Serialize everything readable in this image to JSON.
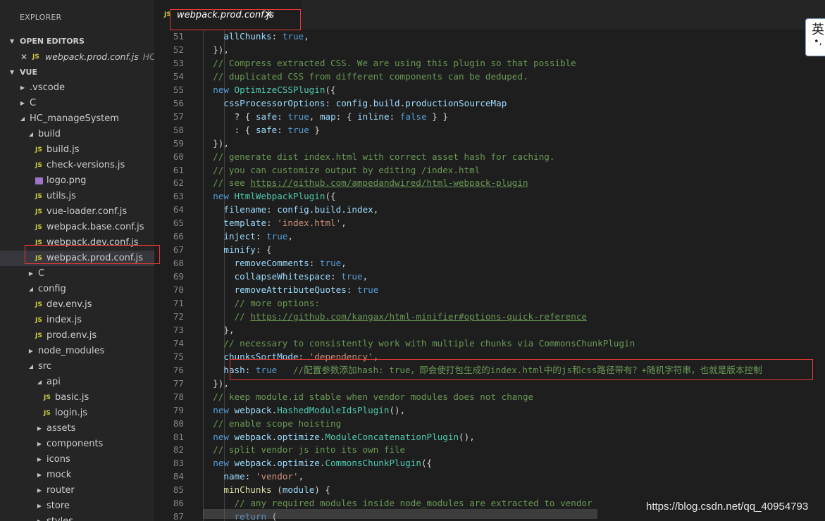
{
  "sidebar": {
    "title": "EXPLORER",
    "open_editors_label": "OPEN EDITORS",
    "open_editor": {
      "name": "webpack.prod.conf.js",
      "path": "HC_..."
    },
    "workspace_label": "VUE",
    "tree": [
      {
        "label": ".vscode",
        "depth": 0,
        "kind": "folder",
        "open": false
      },
      {
        "label": "C",
        "depth": 0,
        "kind": "folder",
        "open": false
      },
      {
        "label": "HC_manageSystem",
        "depth": 0,
        "kind": "folder",
        "open": true
      },
      {
        "label": "build",
        "depth": 1,
        "kind": "folder",
        "open": true
      },
      {
        "label": "build.js",
        "depth": 2,
        "kind": "js"
      },
      {
        "label": "check-versions.js",
        "depth": 2,
        "kind": "js"
      },
      {
        "label": "logo.png",
        "depth": 2,
        "kind": "image"
      },
      {
        "label": "utils.js",
        "depth": 2,
        "kind": "js"
      },
      {
        "label": "vue-loader.conf.js",
        "depth": 2,
        "kind": "js"
      },
      {
        "label": "webpack.base.conf.js",
        "depth": 2,
        "kind": "js"
      },
      {
        "label": "webpack.dev.conf.js",
        "depth": 2,
        "kind": "js"
      },
      {
        "label": "webpack.prod.conf.js",
        "depth": 2,
        "kind": "js",
        "selected": true
      },
      {
        "label": "C",
        "depth": 1,
        "kind": "folder",
        "open": false
      },
      {
        "label": "config",
        "depth": 1,
        "kind": "folder",
        "open": true
      },
      {
        "label": "dev.env.js",
        "depth": 2,
        "kind": "js"
      },
      {
        "label": "index.js",
        "depth": 2,
        "kind": "js"
      },
      {
        "label": "prod.env.js",
        "depth": 2,
        "kind": "js"
      },
      {
        "label": "node_modules",
        "depth": 1,
        "kind": "folder",
        "open": false
      },
      {
        "label": "src",
        "depth": 1,
        "kind": "folder",
        "open": true
      },
      {
        "label": "api",
        "depth": 2,
        "kind": "folder",
        "open": true
      },
      {
        "label": "basic.js",
        "depth": 3,
        "kind": "js"
      },
      {
        "label": "login.js",
        "depth": 3,
        "kind": "js"
      },
      {
        "label": "assets",
        "depth": 2,
        "kind": "folder",
        "open": false
      },
      {
        "label": "components",
        "depth": 2,
        "kind": "folder",
        "open": false
      },
      {
        "label": "icons",
        "depth": 2,
        "kind": "folder",
        "open": false
      },
      {
        "label": "mock",
        "depth": 2,
        "kind": "folder",
        "open": false
      },
      {
        "label": "router",
        "depth": 2,
        "kind": "folder",
        "open": false
      },
      {
        "label": "store",
        "depth": 2,
        "kind": "folder",
        "open": false
      },
      {
        "label": "styles",
        "depth": 2,
        "kind": "folder",
        "open": false
      }
    ]
  },
  "tab": {
    "icon": "JS",
    "name": "webpack.prod.conf.js",
    "close": "✕"
  },
  "js_badge": "JS",
  "ime": {
    "main": "英",
    "sub": "•,"
  },
  "watermark": "https://blog.csdn.net/qq_40954793",
  "colors": {
    "keyword": "#569cd6",
    "comment": "#6a9955",
    "string": "#ce9178",
    "property": "#9cdcfe",
    "class": "#4ec9b0",
    "method": "#dcdcaa",
    "highlight": "#e53935"
  },
  "code_lines": [
    {
      "n": 51,
      "indent": 4,
      "tokens": [
        [
          "p",
          "allChunks"
        ],
        [
          "t",
          ": "
        ],
        [
          "k",
          "true"
        ],
        [
          "t",
          ","
        ]
      ]
    },
    {
      "n": 52,
      "indent": 2,
      "tokens": [
        [
          "t",
          "}),"
        ]
      ]
    },
    {
      "n": 53,
      "indent": 2,
      "tokens": [
        [
          "c",
          "// Compress extracted CSS. We are using this plugin so that possible"
        ]
      ]
    },
    {
      "n": 54,
      "indent": 2,
      "tokens": [
        [
          "c",
          "// duplicated CSS from different components can be deduped."
        ]
      ]
    },
    {
      "n": 55,
      "indent": 2,
      "tokens": [
        [
          "k",
          "new "
        ],
        [
          "f",
          "OptimizeCSSPlugin"
        ],
        [
          "t",
          "({"
        ]
      ]
    },
    {
      "n": 56,
      "indent": 4,
      "tokens": [
        [
          "p",
          "cssProcessorOptions"
        ],
        [
          "t",
          ": "
        ],
        [
          "p",
          "config"
        ],
        [
          "t",
          "."
        ],
        [
          "p",
          "build"
        ],
        [
          "t",
          "."
        ],
        [
          "p",
          "productionSourceMap"
        ]
      ]
    },
    {
      "n": 57,
      "indent": 6,
      "tokens": [
        [
          "t",
          "? { "
        ],
        [
          "p",
          "safe"
        ],
        [
          "t",
          ": "
        ],
        [
          "k",
          "true"
        ],
        [
          "t",
          ", "
        ],
        [
          "p",
          "map"
        ],
        [
          "t",
          ": { "
        ],
        [
          "p",
          "inline"
        ],
        [
          "t",
          ": "
        ],
        [
          "k",
          "false"
        ],
        [
          "t",
          " } }"
        ]
      ]
    },
    {
      "n": 58,
      "indent": 6,
      "tokens": [
        [
          "t",
          ": { "
        ],
        [
          "p",
          "safe"
        ],
        [
          "t",
          ": "
        ],
        [
          "k",
          "true"
        ],
        [
          "t",
          " }"
        ]
      ]
    },
    {
      "n": 59,
      "indent": 2,
      "tokens": [
        [
          "t",
          "}),"
        ]
      ]
    },
    {
      "n": 60,
      "indent": 2,
      "tokens": [
        [
          "c",
          "// generate dist index.html with correct asset hash for caching."
        ]
      ]
    },
    {
      "n": 61,
      "indent": 2,
      "tokens": [
        [
          "c",
          "// you can customize output by editing /index.html"
        ]
      ]
    },
    {
      "n": 62,
      "indent": 2,
      "tokens": [
        [
          "c",
          "// see "
        ],
        [
          "u",
          "https://github.com/ampedandwired/html-webpack-plugin"
        ]
      ]
    },
    {
      "n": 63,
      "indent": 2,
      "tokens": [
        [
          "k",
          "new "
        ],
        [
          "f",
          "HtmlWebpackPlugin"
        ],
        [
          "t",
          "({"
        ]
      ]
    },
    {
      "n": 64,
      "indent": 4,
      "tokens": [
        [
          "p",
          "filename"
        ],
        [
          "t",
          ": "
        ],
        [
          "p",
          "config"
        ],
        [
          "t",
          "."
        ],
        [
          "p",
          "build"
        ],
        [
          "t",
          "."
        ],
        [
          "p",
          "index"
        ],
        [
          "t",
          ","
        ]
      ]
    },
    {
      "n": 65,
      "indent": 4,
      "tokens": [
        [
          "p",
          "template"
        ],
        [
          "t",
          ": "
        ],
        [
          "s",
          "'index.html'"
        ],
        [
          "t",
          ","
        ]
      ]
    },
    {
      "n": 66,
      "indent": 4,
      "tokens": [
        [
          "p",
          "inject"
        ],
        [
          "t",
          ": "
        ],
        [
          "k",
          "true"
        ],
        [
          "t",
          ","
        ]
      ]
    },
    {
      "n": 67,
      "indent": 4,
      "tokens": [
        [
          "p",
          "minify"
        ],
        [
          "t",
          ": {"
        ]
      ]
    },
    {
      "n": 68,
      "indent": 6,
      "tokens": [
        [
          "p",
          "removeComments"
        ],
        [
          "t",
          ": "
        ],
        [
          "k",
          "true"
        ],
        [
          "t",
          ","
        ]
      ]
    },
    {
      "n": 69,
      "indent": 6,
      "tokens": [
        [
          "p",
          "collapseWhitespace"
        ],
        [
          "t",
          ": "
        ],
        [
          "k",
          "true"
        ],
        [
          "t",
          ","
        ]
      ]
    },
    {
      "n": 70,
      "indent": 6,
      "tokens": [
        [
          "p",
          "removeAttributeQuotes"
        ],
        [
          "t",
          ": "
        ],
        [
          "k",
          "true"
        ]
      ]
    },
    {
      "n": 71,
      "indent": 6,
      "tokens": [
        [
          "c",
          "// more options:"
        ]
      ]
    },
    {
      "n": 72,
      "indent": 6,
      "tokens": [
        [
          "c",
          "// "
        ],
        [
          "u",
          "https://github.com/kangax/html-minifier#options-quick-reference"
        ]
      ]
    },
    {
      "n": 73,
      "indent": 4,
      "tokens": [
        [
          "t",
          "},"
        ]
      ]
    },
    {
      "n": 74,
      "indent": 4,
      "tokens": [
        [
          "c",
          "// necessary to consistently work with multiple chunks via CommonsChunkPlugin"
        ]
      ]
    },
    {
      "n": 75,
      "indent": 4,
      "tokens": [
        [
          "p",
          "chunksSortMode"
        ],
        [
          "t",
          ": "
        ],
        [
          "s",
          "'dependency'"
        ],
        [
          "t",
          ","
        ]
      ]
    },
    {
      "n": 76,
      "indent": 4,
      "tokens": [
        [
          "p",
          "hash"
        ],
        [
          "t",
          ": "
        ],
        [
          "k",
          "true"
        ],
        [
          "t",
          "   "
        ],
        [
          "c",
          "//配置参数添加hash: true，即会使打包生成的index.html中的js和css路径带有？+随机字符串，也就是版本控制"
        ]
      ]
    },
    {
      "n": 77,
      "indent": 2,
      "tokens": [
        [
          "t",
          "}),"
        ]
      ]
    },
    {
      "n": 78,
      "indent": 2,
      "tokens": [
        [
          "c",
          "// keep module.id stable when vendor modules does not change"
        ]
      ]
    },
    {
      "n": 79,
      "indent": 2,
      "tokens": [
        [
          "k",
          "new "
        ],
        [
          "p",
          "webpack"
        ],
        [
          "t",
          "."
        ],
        [
          "f",
          "HashedModuleIdsPlugin"
        ],
        [
          "t",
          "(),"
        ]
      ]
    },
    {
      "n": 80,
      "indent": 2,
      "tokens": [
        [
          "c",
          "// enable scope hoisting"
        ]
      ]
    },
    {
      "n": 81,
      "indent": 2,
      "tokens": [
        [
          "k",
          "new "
        ],
        [
          "p",
          "webpack"
        ],
        [
          "t",
          "."
        ],
        [
          "p",
          "optimize"
        ],
        [
          "t",
          "."
        ],
        [
          "f",
          "ModuleConcatenationPlugin"
        ],
        [
          "t",
          "(),"
        ]
      ]
    },
    {
      "n": 82,
      "indent": 2,
      "tokens": [
        [
          "c",
          "// split vendor js into its own file"
        ]
      ]
    },
    {
      "n": 83,
      "indent": 2,
      "tokens": [
        [
          "k",
          "new "
        ],
        [
          "p",
          "webpack"
        ],
        [
          "t",
          "."
        ],
        [
          "p",
          "optimize"
        ],
        [
          "t",
          "."
        ],
        [
          "f",
          "CommonsChunkPlugin"
        ],
        [
          "t",
          "({"
        ]
      ]
    },
    {
      "n": 84,
      "indent": 4,
      "tokens": [
        [
          "p",
          "name"
        ],
        [
          "t",
          ": "
        ],
        [
          "s",
          "'vendor'"
        ],
        [
          "t",
          ","
        ]
      ]
    },
    {
      "n": 85,
      "indent": 4,
      "tokens": [
        [
          "m",
          "minChunks"
        ],
        [
          "t",
          " ("
        ],
        [
          "p",
          "module"
        ],
        [
          "t",
          ") {"
        ]
      ]
    },
    {
      "n": 86,
      "indent": 6,
      "tokens": [
        [
          "c",
          "// any required modules inside node_modules are extracted to vendor"
        ]
      ]
    },
    {
      "n": 87,
      "indent": 6,
      "tokens": [
        [
          "k",
          "return"
        ],
        [
          "t",
          " ("
        ]
      ]
    }
  ]
}
